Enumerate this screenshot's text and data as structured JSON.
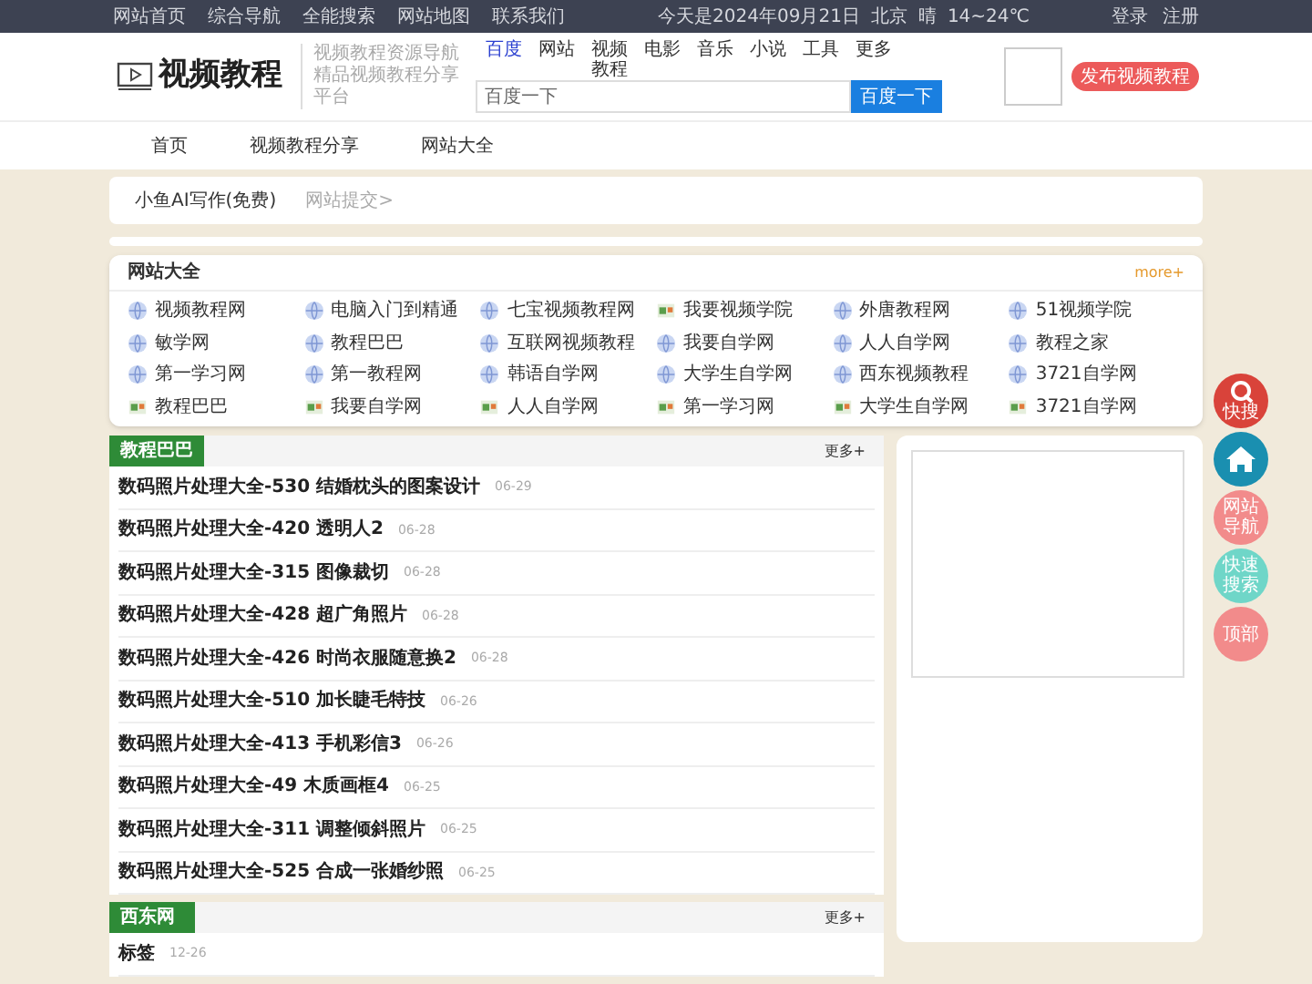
{
  "top_bar": {
    "links": [
      "网站首页",
      "综合导航",
      "全能搜索",
      "网站地图",
      "联系我们"
    ],
    "date": "今天是2024年09月21日",
    "city": "北京",
    "weather": "晴",
    "temp": "14~24℃",
    "account": [
      "登录",
      "注册"
    ]
  },
  "header": {
    "logo": "视频教程",
    "tagline": "视频教程资源导航精品视频教程分享平台",
    "search_tabs": [
      {
        "label": "百度",
        "selected": true
      },
      {
        "label": "网站",
        "selected": false
      },
      {
        "label": "视频教程",
        "selected": false
      },
      {
        "label": "电影",
        "selected": false
      },
      {
        "label": "音乐",
        "selected": false
      },
      {
        "label": "小说",
        "selected": false
      },
      {
        "label": "工具",
        "selected": false
      },
      {
        "label": "更多",
        "selected": false
      }
    ],
    "search_placeholder": "百度一下",
    "search_button": "百度一下",
    "publish_button": "发布视频教程"
  },
  "nav": [
    "首页",
    "视频教程分享",
    "网站大全"
  ],
  "notice_bar": [
    "小鱼AI写作(免费)",
    "网站提交>"
  ],
  "sites": {
    "title": "网站大全",
    "more": "more+",
    "items": [
      {
        "name": "视频教程网"
      },
      {
        "name": "电脑入门到精通"
      },
      {
        "name": "七宝视频教程网"
      },
      {
        "name": "我要视频学院"
      },
      {
        "name": "外唐教程网"
      },
      {
        "name": "51视频学院"
      },
      {
        "name": "敏学网"
      },
      {
        "name": "教程巴巴"
      },
      {
        "name": "互联网视频教程"
      },
      {
        "name": "我要自学网"
      },
      {
        "name": "人人自学网"
      },
      {
        "name": "教程之家"
      },
      {
        "name": "第一学习网"
      },
      {
        "name": "第一教程网"
      },
      {
        "name": "韩语自学网"
      },
      {
        "name": "大学生自学网"
      },
      {
        "name": "西东视频教程"
      },
      {
        "name": "3721自学网"
      },
      {
        "name": "教程巴巴"
      },
      {
        "name": "我要自学网"
      },
      {
        "name": "人人自学网"
      },
      {
        "name": "第一学习网"
      },
      {
        "name": "大学生自学网"
      },
      {
        "name": "3721自学网"
      }
    ]
  },
  "sections": [
    {
      "title": "教程巴巴",
      "more": "更多+",
      "articles": [
        {
          "title": "数码照片处理大全-530 结婚枕头的图案设计",
          "date": "06-29"
        },
        {
          "title": "数码照片处理大全-420 透明人2",
          "date": "06-28"
        },
        {
          "title": "数码照片处理大全-315 图像裁切",
          "date": "06-28"
        },
        {
          "title": "数码照片处理大全-428 超广角照片",
          "date": "06-28"
        },
        {
          "title": "数码照片处理大全-426 时尚衣服随意换2",
          "date": "06-28"
        },
        {
          "title": "数码照片处理大全-510 加长睫毛特技",
          "date": "06-26"
        },
        {
          "title": "数码照片处理大全-413 手机彩信3",
          "date": "06-26"
        },
        {
          "title": "数码照片处理大全-49 木质画框4",
          "date": "06-25"
        },
        {
          "title": "数码照片处理大全-311 调整倾斜照片",
          "date": "06-25"
        },
        {
          "title": "数码照片处理大全-525 合成一张婚纱照",
          "date": "06-25"
        }
      ]
    },
    {
      "title": "西东网",
      "more": "更多+",
      "articles": [
        {
          "title": "标签",
          "date": "12-26"
        }
      ]
    }
  ],
  "float_buttons": [
    {
      "label": "快搜",
      "kind": "search",
      "color": "#d9433a"
    },
    {
      "kind": "home",
      "color": "#1a8fb0"
    },
    {
      "label": "网站导航",
      "kind": "text",
      "color": "#f28b8b"
    },
    {
      "label": "快速搜索",
      "kind": "text",
      "color": "#6fd6c8"
    },
    {
      "label": "顶部",
      "kind": "text",
      "color": "#f28b8b"
    }
  ]
}
